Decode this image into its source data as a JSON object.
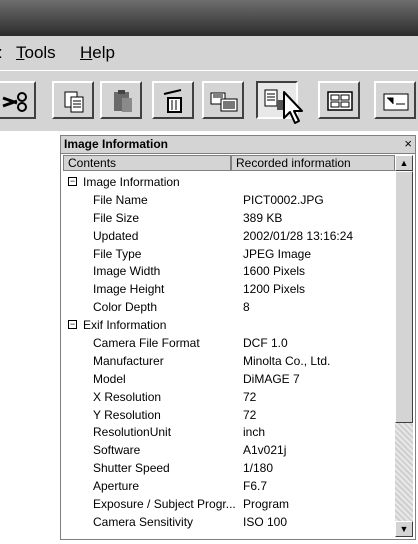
{
  "menu": {
    "edge_label": ":",
    "tools_label": "Tools",
    "help_label": "Help"
  },
  "panel": {
    "title": "Image Information",
    "close_glyph": "×",
    "columns": [
      "Contents",
      "Recorded information"
    ],
    "rows": [
      {
        "type": "section",
        "key": "Image Information",
        "value": "",
        "toggle": "−"
      },
      {
        "type": "item",
        "key": "File Name",
        "value": "PICT0002.JPG"
      },
      {
        "type": "item",
        "key": "File Size",
        "value": "389 KB"
      },
      {
        "type": "item",
        "key": "Updated",
        "value": "2002/01/28 13:16:24"
      },
      {
        "type": "item",
        "key": "File Type",
        "value": "JPEG Image"
      },
      {
        "type": "item",
        "key": "Image Width",
        "value": "1600 Pixels"
      },
      {
        "type": "item",
        "key": "Image Height",
        "value": "1200 Pixels"
      },
      {
        "type": "item",
        "key": "Color Depth",
        "value": "8"
      },
      {
        "type": "section",
        "key": "Exif Information",
        "value": "",
        "toggle": "−"
      },
      {
        "type": "item",
        "key": "Camera File Format",
        "value": "DCF 1.0"
      },
      {
        "type": "item",
        "key": "Manufacturer",
        "value": "Minolta Co., Ltd."
      },
      {
        "type": "item",
        "key": "Model",
        "value": "DiMAGE 7"
      },
      {
        "type": "item",
        "key": "X Resolution",
        "value": "72"
      },
      {
        "type": "item",
        "key": "Y Resolution",
        "value": "72"
      },
      {
        "type": "item",
        "key": "ResolutionUnit",
        "value": "inch"
      },
      {
        "type": "item",
        "key": "Software",
        "value": "A1v021j"
      },
      {
        "type": "item",
        "key": "Shutter Speed",
        "value": "1/180"
      },
      {
        "type": "item",
        "key": "Aperture",
        "value": "F6.7"
      },
      {
        "type": "item",
        "key": "Exposure / Subject Progr...",
        "value": "Program"
      },
      {
        "type": "item",
        "key": "Camera Sensitivity",
        "value": "ISO 100"
      }
    ]
  },
  "toolbar": {
    "icons": [
      "scissors-icon",
      "copy-icon",
      "paste-icon",
      "delete-icon",
      "slideshow-icon",
      "image-info-icon",
      "thumbnail-view-icon",
      "list-view-icon"
    ]
  }
}
